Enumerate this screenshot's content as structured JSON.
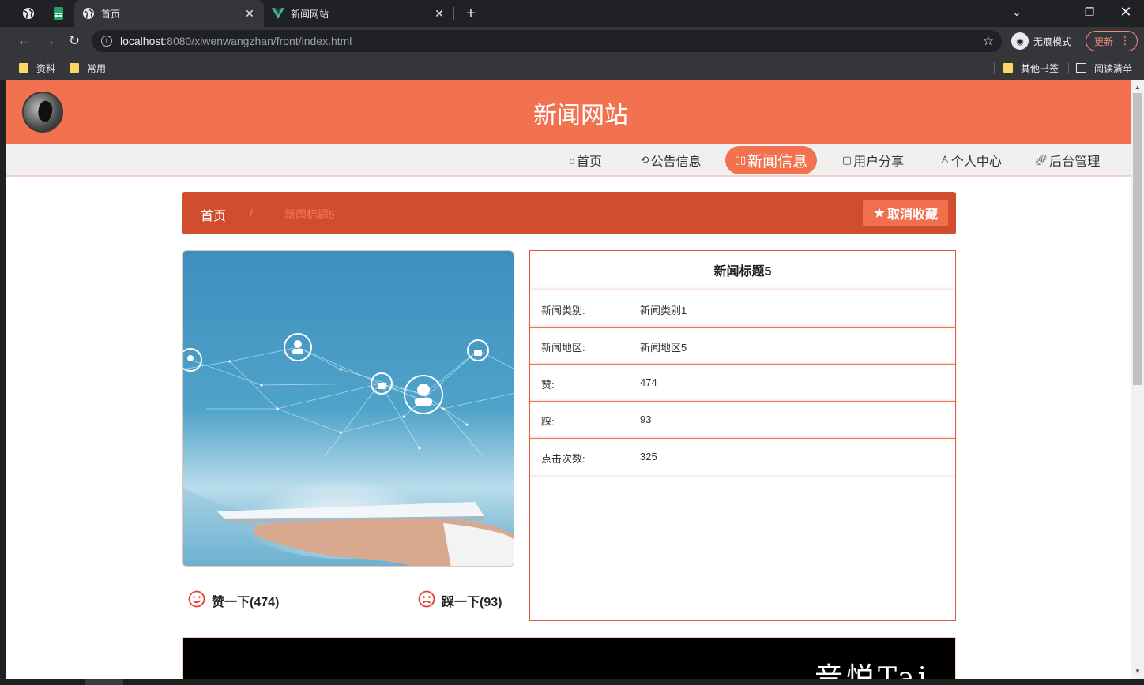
{
  "browser": {
    "tabs": [
      {
        "title": "首页",
        "active": true
      },
      {
        "title": "新闻网站",
        "active": false
      }
    ],
    "url_host": "localhost",
    "url_path": ":8080/xiwenwangzhan/front/index.html",
    "incognito_label": "无痕模式",
    "update_label": "更新",
    "bookmarks": [
      "资料",
      "常用"
    ],
    "bookmarks_right": [
      "其他书签",
      "阅读清单"
    ]
  },
  "site": {
    "title": "新闻网站",
    "nav": [
      {
        "label": "首页",
        "icon": "home-icon"
      },
      {
        "label": "公告信息",
        "icon": "refresh-icon"
      },
      {
        "label": "新闻信息",
        "icon": "news-icon",
        "active": true
      },
      {
        "label": "用户分享",
        "icon": "share-icon"
      },
      {
        "label": "个人中心",
        "icon": "user-icon"
      },
      {
        "label": "后台管理",
        "icon": "link-icon"
      }
    ],
    "accent": "#f2714e",
    "dark_accent": "#d24c2f"
  },
  "breadcrumb": {
    "home": "首页",
    "sep": "/",
    "current": "新闻标题5"
  },
  "favorite_button": "取消收藏",
  "news": {
    "title": "新闻标题5",
    "rows": [
      {
        "label": "新闻类别:",
        "value": "新闻类别1"
      },
      {
        "label": "新闻地区:",
        "value": "新闻地区5"
      },
      {
        "label": "赞:",
        "value": "474"
      },
      {
        "label": "踩:",
        "value": "93"
      },
      {
        "label": "点击次数:",
        "value": "325"
      }
    ]
  },
  "votes": {
    "like": "赞一下(474)",
    "dislike": "踩一下(93)"
  },
  "video": {
    "text": "音悦Tai"
  }
}
